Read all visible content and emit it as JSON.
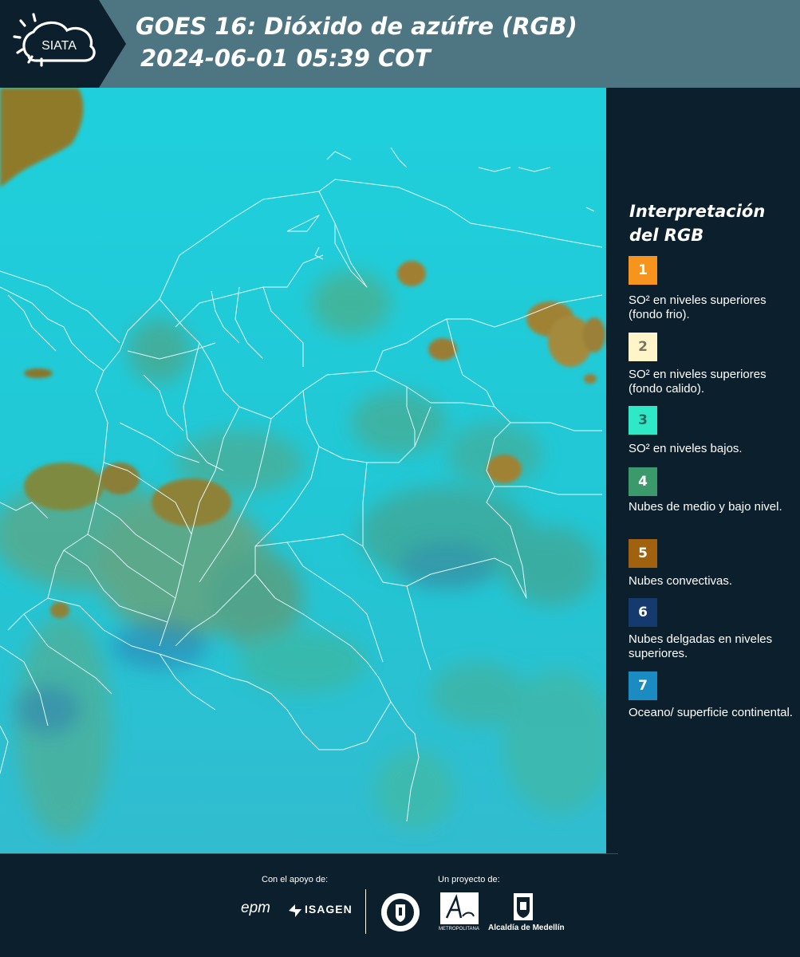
{
  "header": {
    "logo_text": "SIATA",
    "title_line1": "GOES 16: Dióxido de azúfre (RGB)",
    "title_line2": "2024-06-01 05:39 COT"
  },
  "map": {
    "layer": "sulfur-dioxide-rgb-composite",
    "background_color": "#1fc6d6",
    "cloud_colors": [
      "#8a7a2a",
      "#3a9a6a",
      "#2fa8a8"
    ]
  },
  "legend": {
    "title": "Interpretación del RGB",
    "items": [
      {
        "num": "1",
        "color": "#f7941d",
        "num_color": "#ffffff",
        "label": "SO² en niveles superiores (fondo frio)."
      },
      {
        "num": "2",
        "color": "#fff5c8",
        "num_color": "#777766",
        "label": "SO² en niveles superiores (fondo calido)."
      },
      {
        "num": "3",
        "color": "#2ee8c6",
        "num_color": "#2a6a62",
        "label": "SO² en niveles bajos."
      },
      {
        "num": "4",
        "color": "#3b9a6b",
        "num_color": "#ffffff",
        "label": "Nubes de medio y bajo nivel."
      },
      {
        "num": "5",
        "color": "#a0620e",
        "num_color": "#ffffff",
        "label": "Nubes convectivas."
      },
      {
        "num": "6",
        "color": "#143a6e",
        "num_color": "#ffffff",
        "label": "Nubes delgadas en niveles superiores."
      },
      {
        "num": "7",
        "color": "#1a8cc2",
        "num_color": "#ffffff",
        "label": "Oceano/ superficie continental."
      }
    ]
  },
  "footer": {
    "support_label": "Con el apoyo de:",
    "project_label": "Un proyecto de:",
    "sponsor1": "epm",
    "sponsor2": "ISAGEN",
    "area_text": "METROPOLITANA",
    "alcaldia": "Alcaldía de Medellín"
  }
}
